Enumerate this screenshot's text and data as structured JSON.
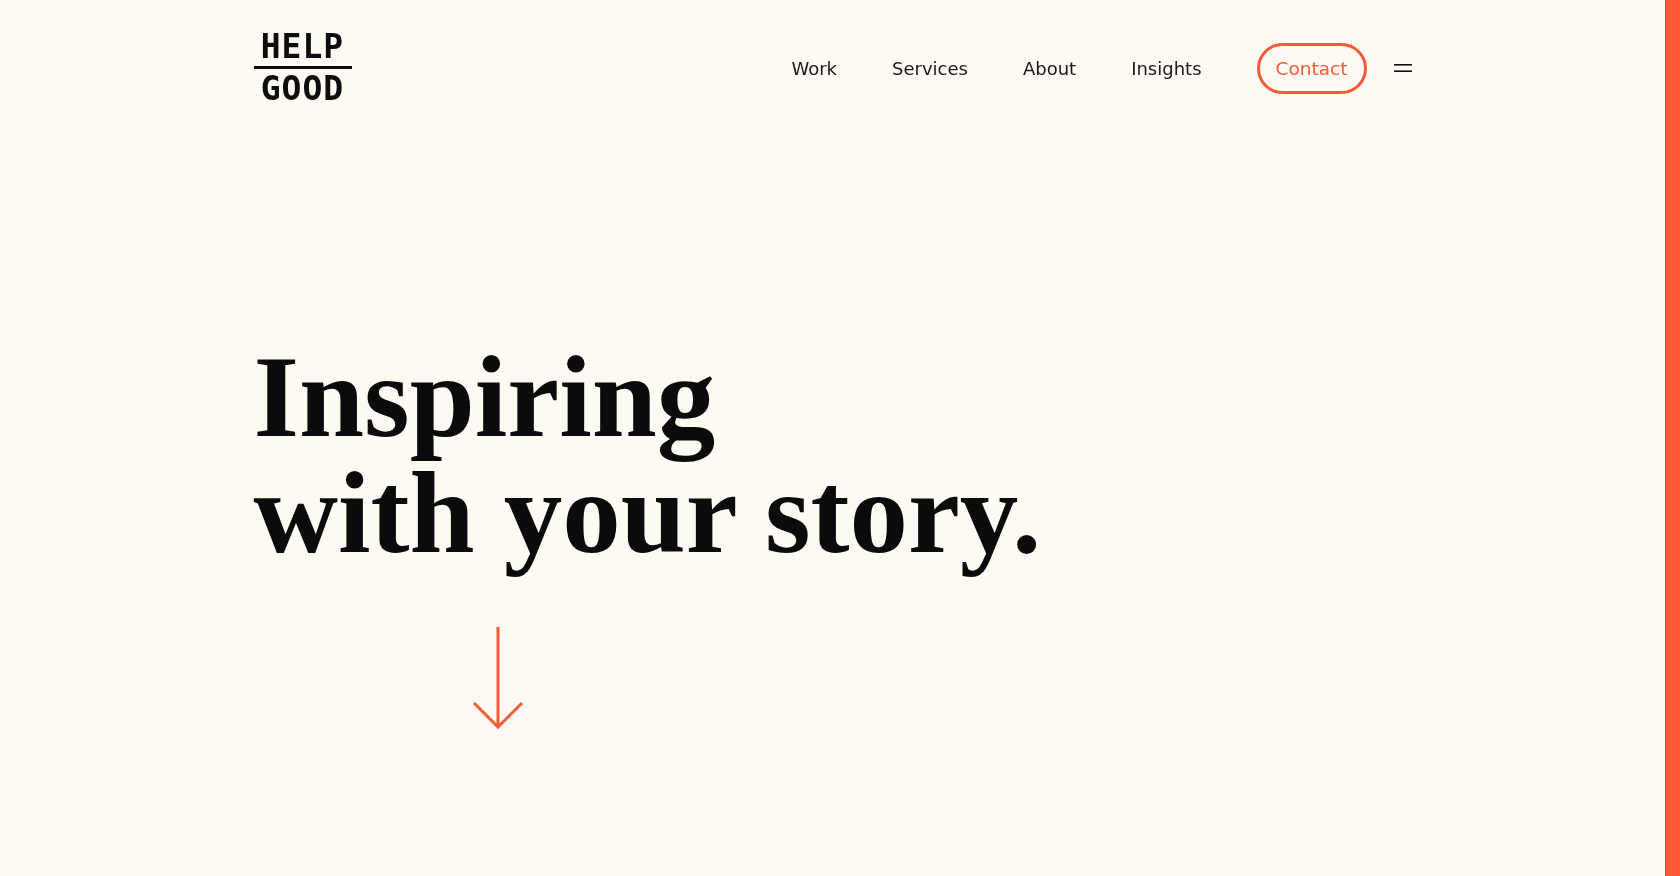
{
  "logo": {
    "top": "HELP",
    "bottom": "GOOD"
  },
  "nav": {
    "links": [
      "Work",
      "Services",
      "About",
      "Insights"
    ],
    "contact": "Contact"
  },
  "hero": {
    "headline_lines": [
      "Inspiring",
      "with your story."
    ]
  }
}
